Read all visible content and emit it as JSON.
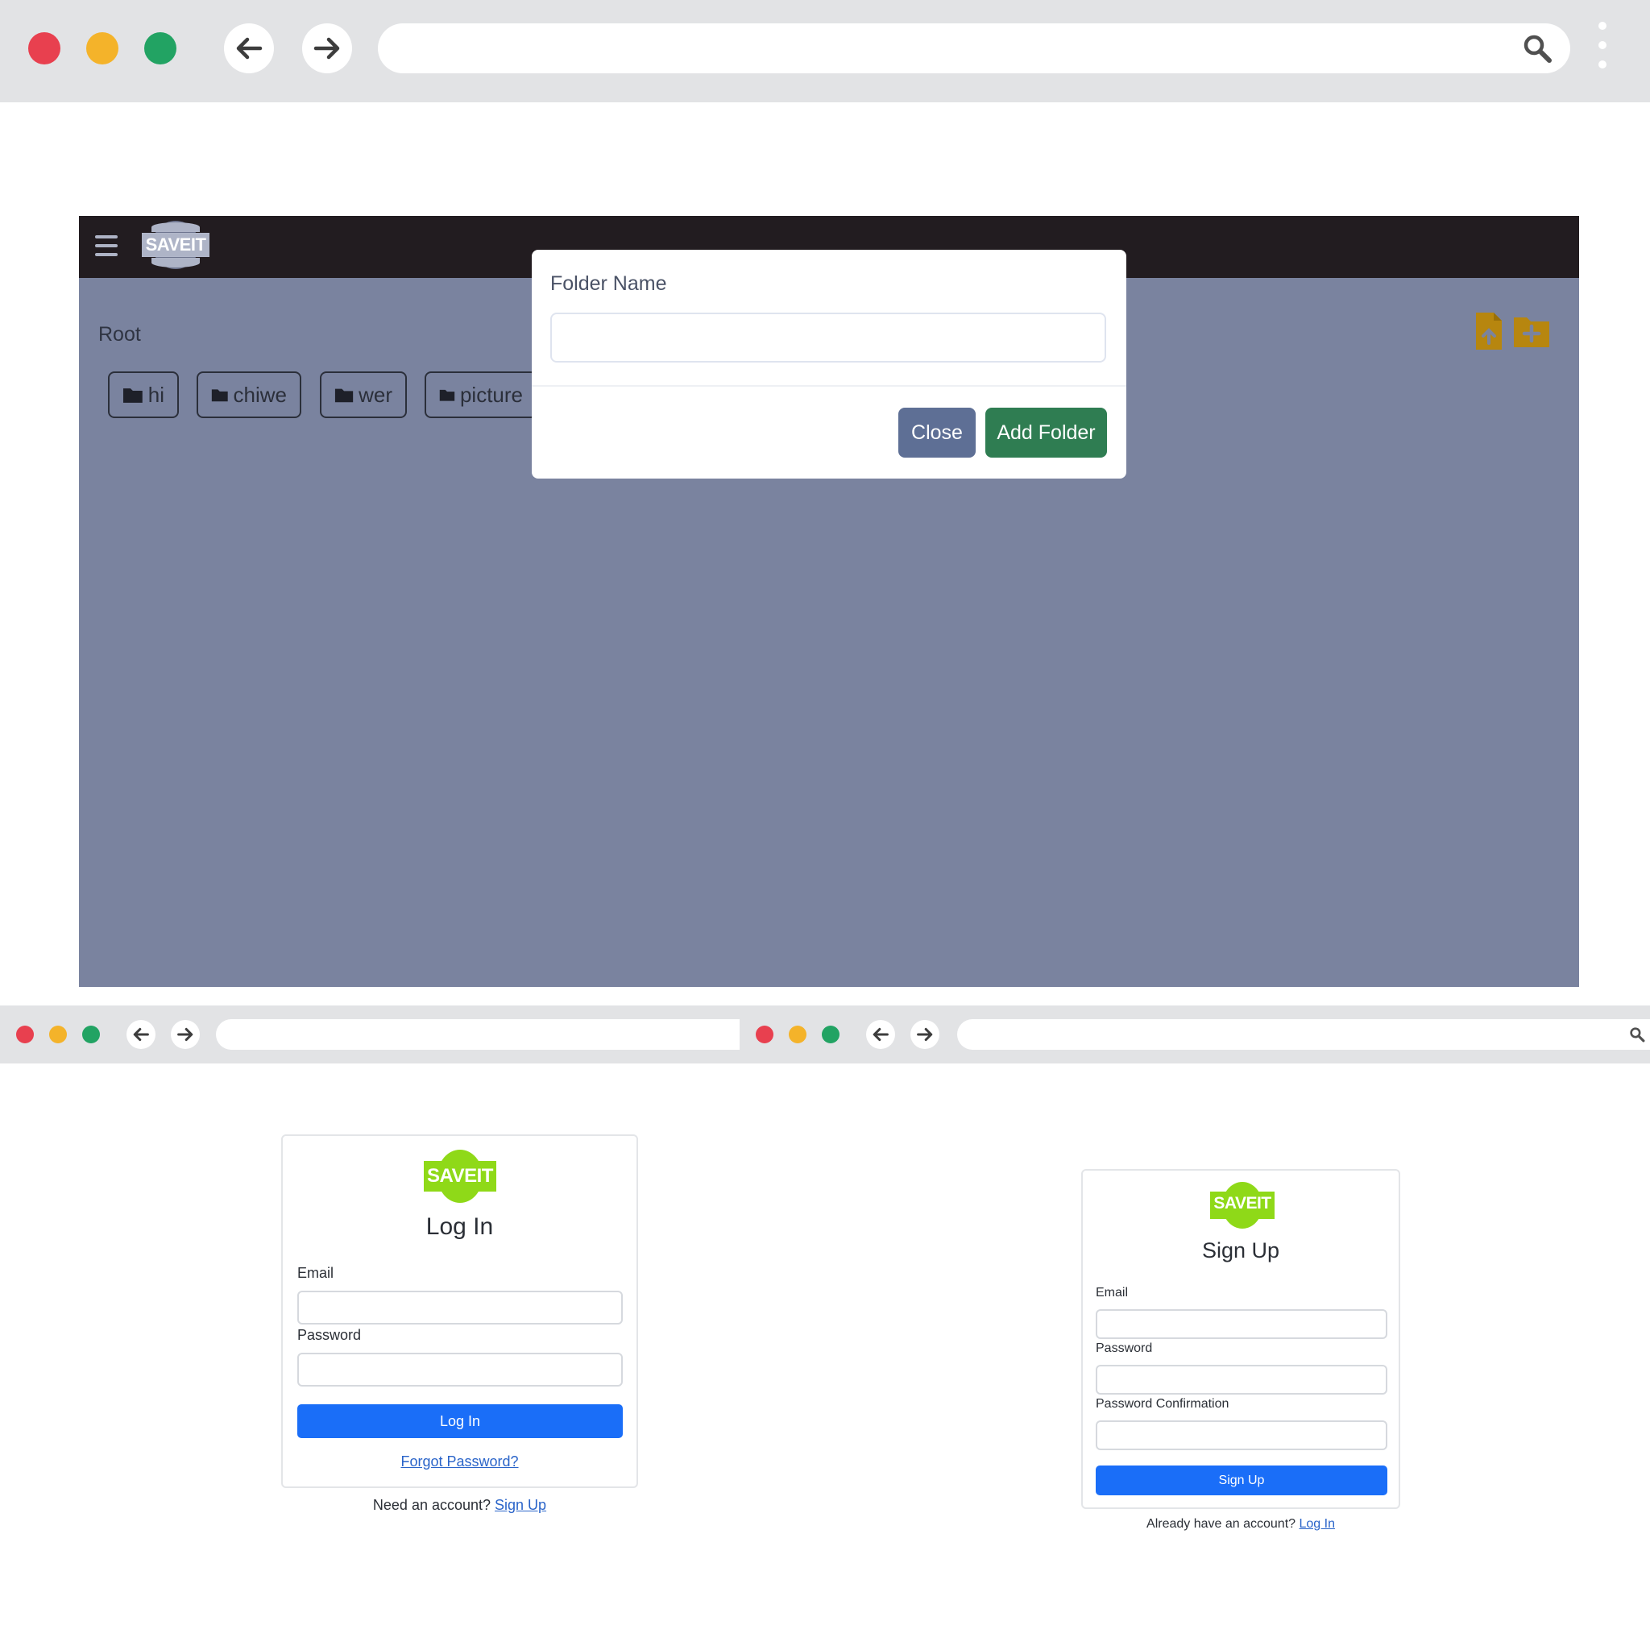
{
  "top_browser": {
    "window_controls": [
      "close",
      "minimize",
      "maximize"
    ],
    "colors": {
      "close": "#e8404f",
      "minimize": "#f4b32a",
      "maximize": "#22a363"
    }
  },
  "app": {
    "logo_text": "SAVEIT",
    "breadcrumb": "Root",
    "folders": [
      {
        "name": "hi"
      },
      {
        "name": "chiwe"
      },
      {
        "name": "wer"
      },
      {
        "name": "picture"
      }
    ],
    "actions": {
      "upload_icon": "file-upload-icon",
      "add_folder_icon": "folder-plus-icon"
    },
    "colors": {
      "navbar": "#221c20",
      "background": "#7a839f",
      "accent": "#b7860f"
    }
  },
  "modal": {
    "label": "Folder Name",
    "input_value": "",
    "close_label": "Close",
    "submit_label": "Add Folder",
    "colors": {
      "close": "#5e6f95",
      "submit": "#2f7d52"
    }
  },
  "login": {
    "logo_text": "SAVEIT",
    "title": "Log In",
    "email_label": "Email",
    "password_label": "Password",
    "submit_label": "Log In",
    "forgot_link": "Forgot Password?",
    "footer_text": "Need an account?",
    "footer_link": "Sign Up"
  },
  "signup": {
    "logo_text": "SAVEIT",
    "title": "Sign Up",
    "email_label": "Email",
    "password_label": "Password",
    "confirm_label": "Password Confirmation",
    "submit_label": "Sign Up",
    "footer_text": "Already have an account?",
    "footer_link": "Log In"
  },
  "brand_colors": {
    "logo_green": "#8fd918",
    "primary_blue": "#1a6ef8"
  }
}
